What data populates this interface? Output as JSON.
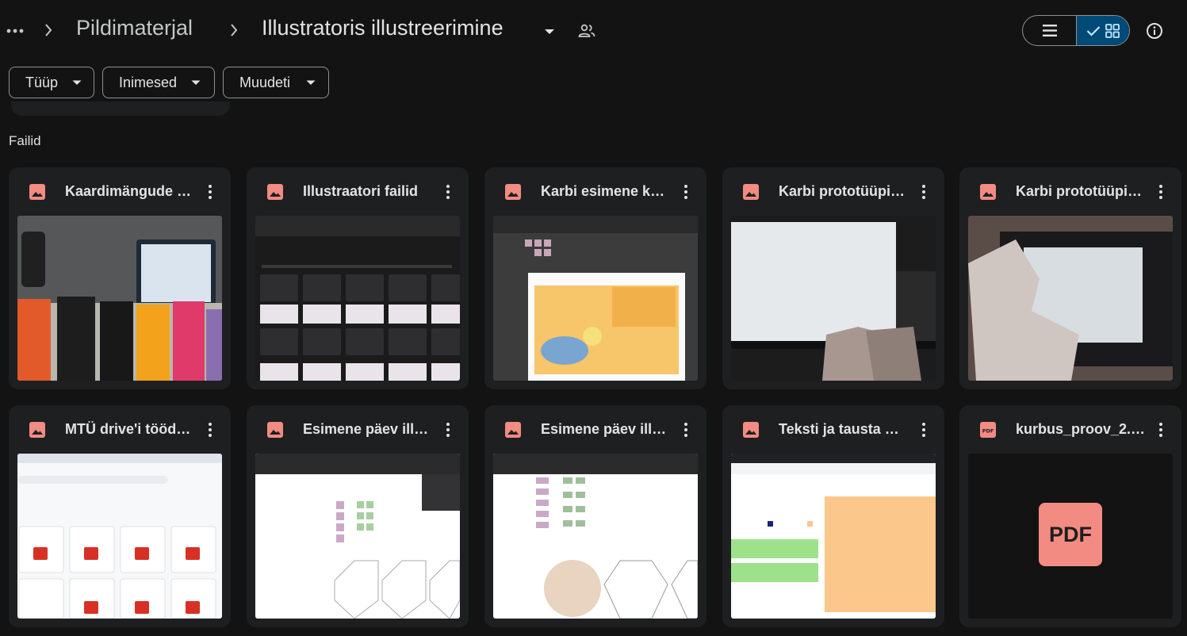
{
  "breadcrumb": {
    "more_label": "…",
    "items": [
      "Pildimaterjal",
      "Illustratoris illustreerimine"
    ]
  },
  "icons": {
    "more": "more-horizontal-icon",
    "chevron": "chevron-right-icon",
    "dropdown": "arrow-drop-down-icon",
    "shared": "people-icon",
    "list_view": "list-view-icon",
    "grid_view": "grid-view-icon",
    "check": "check-icon",
    "info": "info-icon",
    "image_file": "image-file-icon",
    "pdf_file": "pdf-file-icon",
    "more_vert": "more-vertical-icon"
  },
  "filters": [
    {
      "label": "Tüüp"
    },
    {
      "label": "Inimesed"
    },
    {
      "label": "Muudeti"
    }
  ],
  "section_title": "Failid",
  "colors": {
    "background": "#131314",
    "card": "#1e1f20",
    "selected_toggle": "#004a77",
    "accent": "#a8c7fa",
    "image_icon": "#f28b82",
    "pdf_icon": "#f28b82"
  },
  "files": [
    {
      "name": "Kaardimängude …",
      "type": "image"
    },
    {
      "name": "Illustraatori failid",
      "type": "image"
    },
    {
      "name": "Karbi esimene k…",
      "type": "image"
    },
    {
      "name": "Karbi prototüüpi…",
      "type": "image"
    },
    {
      "name": "Karbi prototüüpi…",
      "type": "image"
    },
    {
      "name": "MTÜ drive'i tööd…",
      "type": "image"
    },
    {
      "name": "Esimene päev ill…",
      "type": "image"
    },
    {
      "name": "Esimene päev ill…",
      "type": "image"
    },
    {
      "name": "Teksti ja tausta …",
      "type": "image"
    },
    {
      "name": "kurbus_proov_2.…",
      "type": "pdf",
      "preview_label": "PDF"
    }
  ]
}
